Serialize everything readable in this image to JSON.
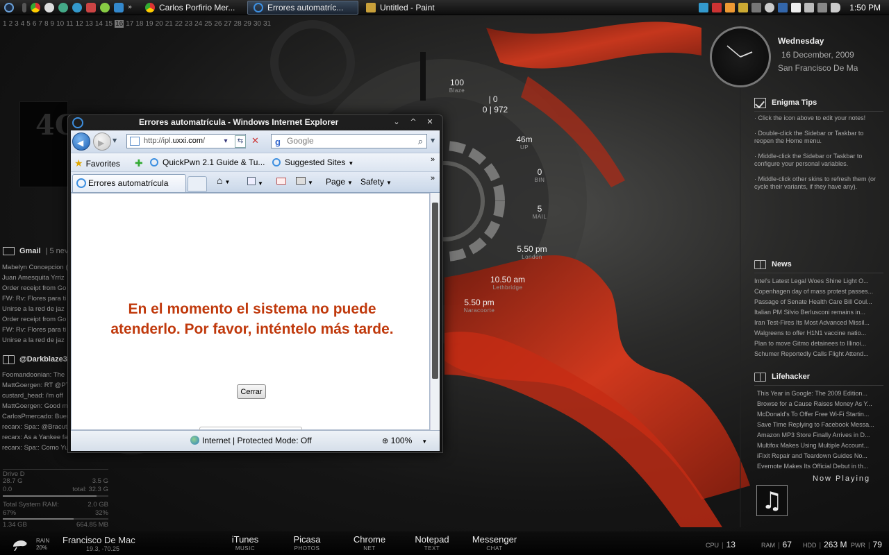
{
  "taskbar": {
    "tasks": [
      {
        "label": "Carlos Porfirio Mer..."
      },
      {
        "label": "Errores automatríc..."
      },
      {
        "label": "Untitled - Paint"
      }
    ],
    "time": "1:50 PM"
  },
  "calendar": {
    "days": [
      "1",
      "2",
      "3",
      "4",
      "5",
      "6",
      "7",
      "8",
      "9",
      "10",
      "11",
      "12",
      "13",
      "14",
      "15",
      "16",
      "17",
      "18",
      "19",
      "20",
      "21",
      "22",
      "23",
      "24",
      "25",
      "26",
      "27",
      "28",
      "29",
      "30",
      "31"
    ],
    "today": "16"
  },
  "gauges": [
    {
      "value": "100",
      "sub": "Blaze"
    },
    {
      "value": "| 0",
      "sub": ""
    },
    {
      "value": "0 | 972",
      "sub": ""
    },
    {
      "value": "46m",
      "sub": "UP"
    },
    {
      "value": "0",
      "sub": "BIN"
    },
    {
      "value": "5",
      "sub": "MAIL"
    },
    {
      "value": "5.50 pm",
      "sub": "London"
    },
    {
      "value": "10.50 am",
      "sub": "Lethbridge"
    },
    {
      "value": "5.50 pm",
      "sub": "Naracoorte"
    }
  ],
  "left_panel": {
    "gmail_title": "Gmail",
    "gmail_count": "| 5 nev",
    "gmail_items": [
      "Mabelyn Concepcion (",
      "Juan Amesquita Yrriz",
      "Order receipt from Go",
      "FW: Rv: Flores para ti",
      "Unirse a la red de jaz",
      "Order receipt from Go",
      "FW: Rv: Flores para ti",
      "Unirse a la red de jaz"
    ],
    "twitter_title": "@Darkblaze3",
    "twitter_items": [
      "Foomandoonian: The",
      "MattGoergen: RT @PT",
      "custard_head: i'm off",
      "MattGoergen: Good m",
      "CarlosPmercado: Buer",
      "recarx: Spa:: @Bracut",
      "recarx: As a Yankee fa",
      "recarx: Spa:: Como Yu"
    ],
    "drive": {
      "title": "Drive D",
      "used": "28.7 G",
      "free_gb": "3.5 G",
      "free": "0.0",
      "total": "total: 32.3 G",
      "ram_label": "Total System RAM:",
      "ram_total": "2.0 GB",
      "ram_pct_a": "67%",
      "ram_pct_b": "32%",
      "ram_a": "1.34 GB",
      "ram_b": "664.85 MB",
      "drive_usage_fraction": 0.89,
      "ram_usage_fraction": 0.67
    }
  },
  "right_panel": {
    "day_name": "Wednesday",
    "date": "16 December, 2009",
    "city": "San Francisco De Mac",
    "tips_title": "Enigma Tips",
    "tips": [
      "· Click the icon above to edit your notes!",
      "· Double-click the Sidebar or Taskbar to reopen the Home menu.",
      "· Middle-click the Sidebar or Taskbar to configure your personal variables.",
      "· Middle-click other skins to refresh them (or cycle their variants, if they have any)."
    ],
    "news_title": "News",
    "news": [
      "Intel's Latest Legal Woes Shine Light O...",
      "Copenhagen day of mass protest passes...",
      "Passage of Senate Health Care Bill Coul...",
      "Italian PM Silvio Berlusconi remains in...",
      "Iran Test-Fires Its Most Advanced Missil...",
      "Walgreens to offer H1N1 vaccine natio...",
      "Plan to move Gitmo detainees to Illinoi...",
      "Schumer Reportedly Calls Flight Attend..."
    ],
    "lifehacker_title": "Lifehacker",
    "lifehacker": [
      "This Year in Google: The 2009 Edition...",
      "Browse for a Cause Raises Money As Y...",
      "McDonald's To Offer Free Wi-Fi Startin...",
      "Save Time Replying to Facebook Messa...",
      "Amazon MP3 Store Finally Arrives in D...",
      "Multifox Makes Using Multiple Account...",
      "iFixit Repair and Teardown Guides No...",
      "Evernote Makes Its Official Debut in th..."
    ],
    "now_playing": "Now Playing"
  },
  "bottom": {
    "weather_label": "RAIN",
    "weather_pct": "20%",
    "weather_city": "Francisco De Mac",
    "weather_coord": "19.3, -70.25",
    "dock": [
      {
        "label": "iTunes",
        "sub": "MUSIC"
      },
      {
        "label": "Picasa",
        "sub": "PHOTOS"
      },
      {
        "label": "Chrome",
        "sub": "NET"
      },
      {
        "label": "Notepad",
        "sub": "TEXT"
      },
      {
        "label": "Messenger",
        "sub": "CHAT"
      }
    ],
    "stats": [
      {
        "k": "CPU",
        "v": "13"
      },
      {
        "k": "RAM",
        "v": "67"
      },
      {
        "k": "HDD",
        "v": "263 M"
      },
      {
        "k": "PWR",
        "v": "79"
      }
    ]
  },
  "ie": {
    "title": "Errores automatrícula - Windows Internet Explorer",
    "address_prefix": "http://ipl.",
    "address_domain": "uxxi.com",
    "address_suffix": "/",
    "search_placeholder": "Google",
    "favorites_label": "Favorites",
    "fav_links": [
      "QuickPwn 2.1 Guide & Tu...",
      "Suggested Sites"
    ],
    "tab_label": "Errores automatrícula",
    "commands": {
      "page": "Page",
      "safety": "Safety"
    },
    "error_message": "En el momento el sistema no puede atenderlo. Por favor, inténtelo más tarde.",
    "close_button": "Cerrar",
    "status_zone": "Internet | Protected Mode: Off",
    "zoom": "100%"
  },
  "colors": {
    "error_text": "#c0390c",
    "wallpaper_ribbon": "#d8341a",
    "ie_blue": "#3d8fe0"
  }
}
